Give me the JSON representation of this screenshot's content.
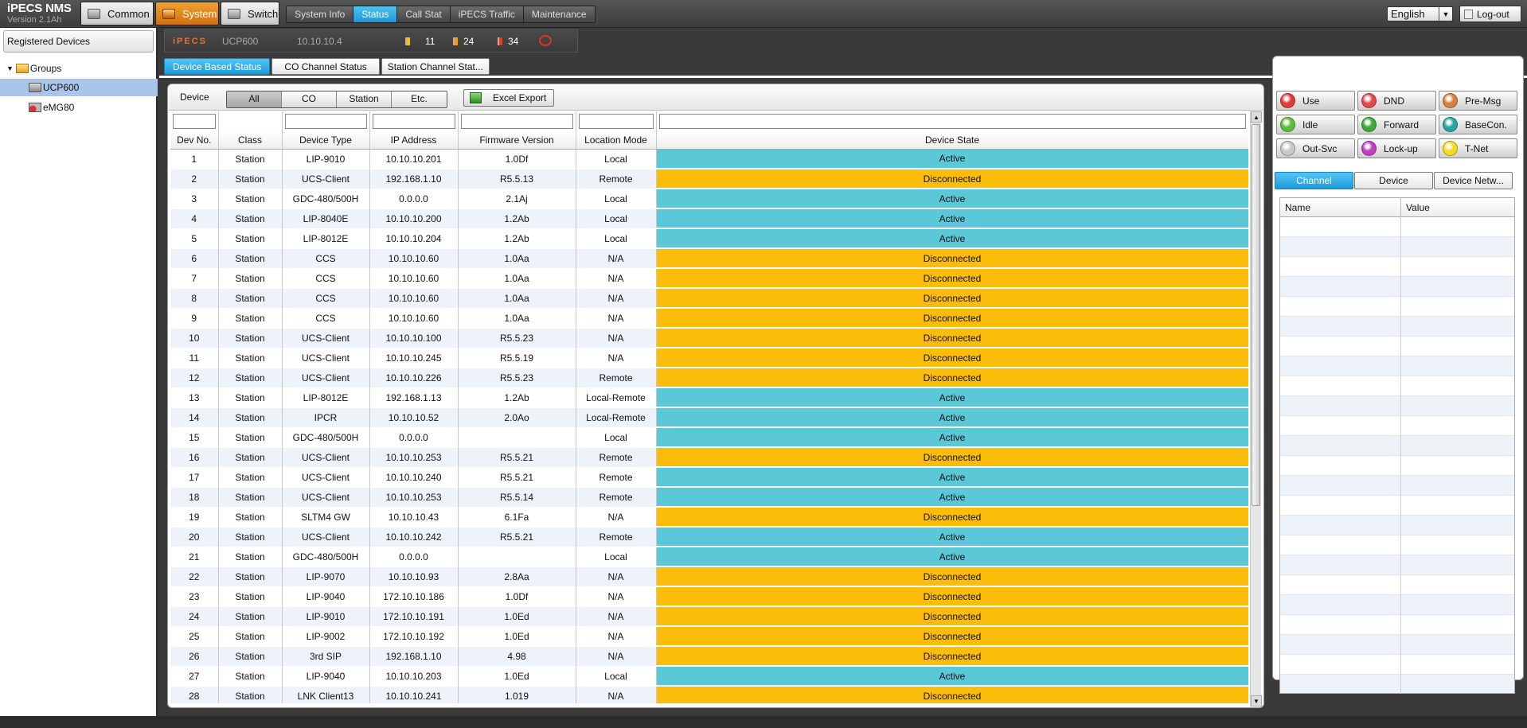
{
  "app": {
    "title": "iPECS NMS",
    "version": "Version 2.1Ah"
  },
  "main_tabs": [
    {
      "label": "Common",
      "active": false
    },
    {
      "label": "System",
      "active": true
    },
    {
      "label": "Switch",
      "active": false
    }
  ],
  "sub_tabs": [
    {
      "label": "System Info",
      "active": false
    },
    {
      "label": "Status",
      "active": true
    },
    {
      "label": "Call Stat",
      "active": false
    },
    {
      "label": "iPECS Traffic",
      "active": false
    },
    {
      "label": "Maintenance",
      "active": false
    }
  ],
  "language": {
    "value": "English"
  },
  "logout_label": "Log-out",
  "sidebar": {
    "title": "Registered Devices",
    "root": "Groups",
    "items": [
      {
        "label": "UCP600",
        "selected": true
      },
      {
        "label": "eMG80",
        "selected": false
      }
    ]
  },
  "device_bar": {
    "brand": "iPECS",
    "model": "UCP600",
    "ip": "10.10.10.4",
    "flag_yellow": "11",
    "flag_orange": "24",
    "flag_red": "34"
  },
  "view_tabs": [
    {
      "label": "Device Based Status",
      "active": true
    },
    {
      "label": "CO Channel Status",
      "active": false
    },
    {
      "label": "Station Channel Stat...",
      "active": false
    }
  ],
  "filter": {
    "label": "Device",
    "segments": [
      {
        "label": "All",
        "active": true
      },
      {
        "label": "CO",
        "active": false
      },
      {
        "label": "Station",
        "active": false
      },
      {
        "label": "Etc.",
        "active": false
      }
    ],
    "export_label": "Excel Export"
  },
  "columns": [
    "Dev No.",
    "Class",
    "Device Type",
    "IP Address",
    "Firmware Version",
    "Location Mode",
    "Device State"
  ],
  "rows": [
    [
      "1",
      "Station",
      "LIP-9010",
      "10.10.10.201",
      "1.0Df",
      "Local",
      "Active"
    ],
    [
      "2",
      "Station",
      "UCS-Client",
      "192.168.1.10",
      "R5.5.13",
      "Remote",
      "Disconnected"
    ],
    [
      "3",
      "Station",
      "GDC-480/500H",
      "0.0.0.0",
      "2.1Aj",
      "Local",
      "Active"
    ],
    [
      "4",
      "Station",
      "LIP-8040E",
      "10.10.10.200",
      "1.2Ab",
      "Local",
      "Active"
    ],
    [
      "5",
      "Station",
      "LIP-8012E",
      "10.10.10.204",
      "1.2Ab",
      "Local",
      "Active"
    ],
    [
      "6",
      "Station",
      "CCS",
      "10.10.10.60",
      "1.0Aa",
      "N/A",
      "Disconnected"
    ],
    [
      "7",
      "Station",
      "CCS",
      "10.10.10.60",
      "1.0Aa",
      "N/A",
      "Disconnected"
    ],
    [
      "8",
      "Station",
      "CCS",
      "10.10.10.60",
      "1.0Aa",
      "N/A",
      "Disconnected"
    ],
    [
      "9",
      "Station",
      "CCS",
      "10.10.10.60",
      "1.0Aa",
      "N/A",
      "Disconnected"
    ],
    [
      "10",
      "Station",
      "UCS-Client",
      "10.10.10.100",
      "R5.5.23",
      "N/A",
      "Disconnected"
    ],
    [
      "11",
      "Station",
      "UCS-Client",
      "10.10.10.245",
      "R5.5.19",
      "N/A",
      "Disconnected"
    ],
    [
      "12",
      "Station",
      "UCS-Client",
      "10.10.10.226",
      "R5.5.23",
      "Remote",
      "Disconnected"
    ],
    [
      "13",
      "Station",
      "LIP-8012E",
      "192.168.1.13",
      "1.2Ab",
      "Local-Remote",
      "Active"
    ],
    [
      "14",
      "Station",
      "IPCR",
      "10.10.10.52",
      "2.0Ao",
      "Local-Remote",
      "Active"
    ],
    [
      "15",
      "Station",
      "GDC-480/500H",
      "0.0.0.0",
      "",
      "Local",
      "Active"
    ],
    [
      "16",
      "Station",
      "UCS-Client",
      "10.10.10.253",
      "R5.5.21",
      "Remote",
      "Disconnected"
    ],
    [
      "17",
      "Station",
      "UCS-Client",
      "10.10.10.240",
      "R5.5.21",
      "Remote",
      "Active"
    ],
    [
      "18",
      "Station",
      "UCS-Client",
      "10.10.10.253",
      "R5.5.14",
      "Remote",
      "Active"
    ],
    [
      "19",
      "Station",
      "SLTM4 GW",
      "10.10.10.43",
      "6.1Fa",
      "N/A",
      "Disconnected"
    ],
    [
      "20",
      "Station",
      "UCS-Client",
      "10.10.10.242",
      "R5.5.21",
      "Remote",
      "Active"
    ],
    [
      "21",
      "Station",
      "GDC-480/500H",
      "0.0.0.0",
      "",
      "Local",
      "Active"
    ],
    [
      "22",
      "Station",
      "LIP-9070",
      "10.10.10.93",
      "2.8Aa",
      "N/A",
      "Disconnected"
    ],
    [
      "23",
      "Station",
      "LIP-9040",
      "172.10.10.186",
      "1.0Df",
      "N/A",
      "Disconnected"
    ],
    [
      "24",
      "Station",
      "LIP-9010",
      "172.10.10.191",
      "1.0Ed",
      "N/A",
      "Disconnected"
    ],
    [
      "25",
      "Station",
      "LIP-9002",
      "172.10.10.192",
      "1.0Ed",
      "N/A",
      "Disconnected"
    ],
    [
      "26",
      "Station",
      "3rd SIP",
      "192.168.1.10",
      "4.98",
      "N/A",
      "Disconnected"
    ],
    [
      "27",
      "Station",
      "LIP-9040",
      "10.10.10.203",
      "1.0Ed",
      "Local",
      "Active"
    ],
    [
      "28",
      "Station",
      "LNK Client13",
      "10.10.10.241",
      "1.019",
      "N/A",
      "Disconnected"
    ]
  ],
  "state_colors": {
    "Active": "#5bc8d8",
    "Disconnected": "#fbbd0a"
  },
  "legend": [
    {
      "label": "Use",
      "color": "#e23b3b"
    },
    {
      "label": "DND",
      "color": "#e24a4a"
    },
    {
      "label": "Pre-Msg",
      "color": "#d98040"
    },
    {
      "label": "Idle",
      "color": "#5cbf3a"
    },
    {
      "label": "Forward",
      "color": "#3ea83a"
    },
    {
      "label": "BaseCon.",
      "color": "#2aa5a0"
    },
    {
      "label": "Out-Svc",
      "color": "#c8c8c8"
    },
    {
      "label": "Lock-up",
      "color": "#c040c0"
    },
    {
      "label": "T-Net",
      "color": "#f5dc20"
    }
  ],
  "right_tabs": [
    {
      "label": "Channel",
      "active": true
    },
    {
      "label": "Device",
      "active": false
    },
    {
      "label": "Device Netw...",
      "active": false
    }
  ],
  "nv_headers": [
    "Name",
    "Value"
  ]
}
